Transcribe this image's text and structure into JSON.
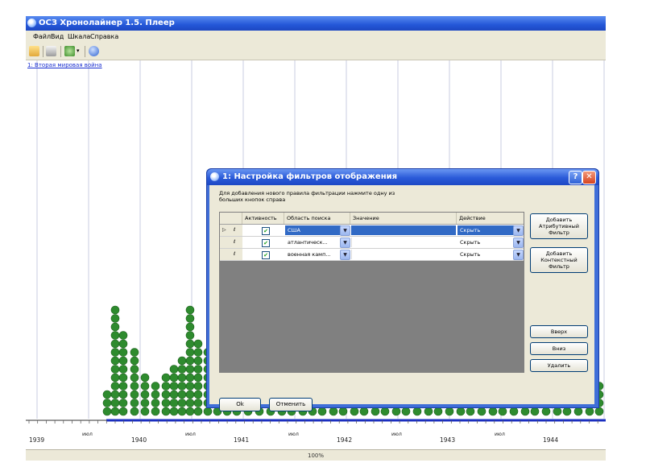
{
  "window": {
    "title": "ОСЗ Хронолайнер 1.5. Плеер"
  },
  "menu": {
    "items": [
      "Файл",
      "Вид",
      "Шкала",
      "Справка"
    ]
  },
  "toolbar": {
    "icons": [
      "open-icon",
      "print-icon",
      "settings-icon",
      "help-icon"
    ]
  },
  "document": {
    "link": "1: Вторая мировая война"
  },
  "timeline": {
    "year_labels": [
      "1939",
      "1940",
      "1941",
      "1942",
      "1943",
      "1944"
    ],
    "mid_labels": [
      "июл",
      "июл",
      "июл",
      "июл",
      "июл"
    ],
    "zoom": "100%",
    "dot_color": "#2e8b2e"
  },
  "dialog": {
    "title": "1: Настройка фильтров отображения",
    "help_label": "?",
    "close_label": "✕",
    "instructions": "Для добавления нового правила фильтрации нажмите одну из больших кнопок справа",
    "columns": [
      "Активность",
      "Область поиска",
      "Значение",
      "Действие"
    ],
    "rows": [
      {
        "marker": "▷",
        "edit": "ℓ",
        "active": true,
        "scope": "США",
        "value": "",
        "action": "Скрыть",
        "selected": true
      },
      {
        "marker": "",
        "edit": "ℓ",
        "active": true,
        "scope": "атлантическ...",
        "value": "",
        "action": "Скрыть",
        "selected": false
      },
      {
        "marker": "",
        "edit": "ℓ",
        "active": true,
        "scope": "военная камп...",
        "value": "",
        "action": "Скрыть",
        "selected": false
      }
    ],
    "buttons": {
      "add_attribute": "Добавить\nАтрибутивный\nФильтр",
      "add_context": "Добавить\nКонтекстный\nФильтр",
      "up": "Вверх",
      "down": "Вниз",
      "delete": "Удалить",
      "ok": "Ok",
      "cancel": "Отменить"
    }
  }
}
